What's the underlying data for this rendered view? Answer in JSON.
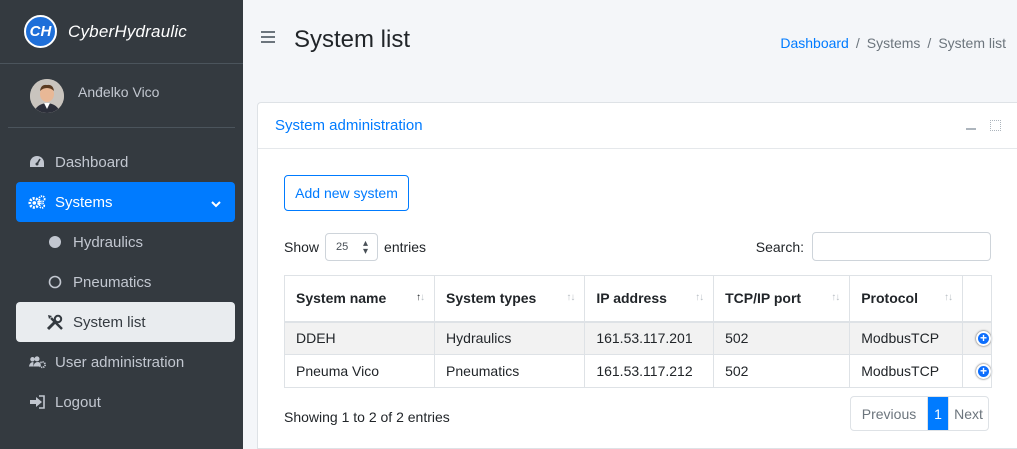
{
  "brand": {
    "logo": "CH",
    "name": "CyberHydraulic"
  },
  "user": {
    "name": "Anđelko Vico"
  },
  "nav": {
    "dashboard": "Dashboard",
    "systems": "Systems",
    "hydraulics": "Hydraulics",
    "pneumatics": "Pneumatics",
    "system_list": "System list",
    "user_admin": "User administration",
    "logout": "Logout"
  },
  "header": {
    "title": "System list",
    "breadcrumb": [
      "Dashboard",
      "Systems",
      "System list"
    ]
  },
  "card": {
    "title": "System administration",
    "add_button": "Add new system",
    "show_label": "Show",
    "entries_label": "entries",
    "length_value": "25",
    "search_label": "Search:",
    "search_value": ""
  },
  "table": {
    "columns": [
      "System name",
      "System types",
      "IP address",
      "TCP/IP port",
      "Protocol"
    ],
    "rows": [
      [
        "DDEH",
        "Hydraulics",
        "161.53.117.201",
        "502",
        "ModbusTCP"
      ],
      [
        "Pneuma Vico",
        "Pneumatics",
        "161.53.117.212",
        "502",
        "ModbusTCP"
      ]
    ]
  },
  "footer": {
    "info": "Showing 1 to 2 of 2 entries",
    "prev": "Previous",
    "page": "1",
    "next": "Next"
  },
  "colors": {
    "accent": "#007bff",
    "sidebar": "#343a40"
  }
}
